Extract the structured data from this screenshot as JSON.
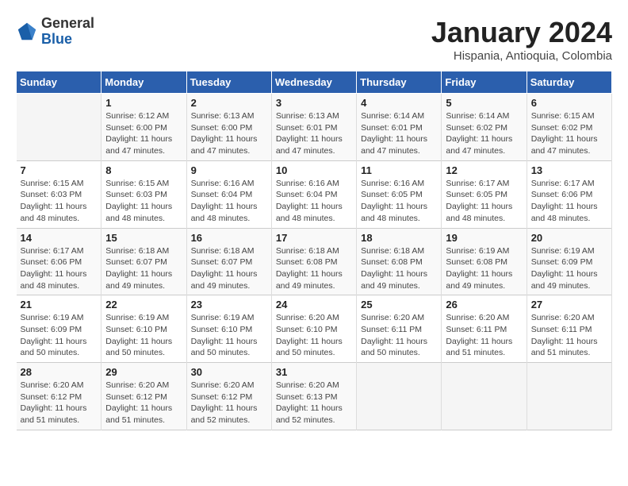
{
  "logo": {
    "general": "General",
    "blue": "Blue"
  },
  "title": "January 2024",
  "subtitle": "Hispania, Antioquia, Colombia",
  "days_of_week": [
    "Sunday",
    "Monday",
    "Tuesday",
    "Wednesday",
    "Thursday",
    "Friday",
    "Saturday"
  ],
  "weeks": [
    [
      {
        "day": "",
        "detail": ""
      },
      {
        "day": "1",
        "detail": "Sunrise: 6:12 AM\nSunset: 6:00 PM\nDaylight: 11 hours\nand 47 minutes."
      },
      {
        "day": "2",
        "detail": "Sunrise: 6:13 AM\nSunset: 6:00 PM\nDaylight: 11 hours\nand 47 minutes."
      },
      {
        "day": "3",
        "detail": "Sunrise: 6:13 AM\nSunset: 6:01 PM\nDaylight: 11 hours\nand 47 minutes."
      },
      {
        "day": "4",
        "detail": "Sunrise: 6:14 AM\nSunset: 6:01 PM\nDaylight: 11 hours\nand 47 minutes."
      },
      {
        "day": "5",
        "detail": "Sunrise: 6:14 AM\nSunset: 6:02 PM\nDaylight: 11 hours\nand 47 minutes."
      },
      {
        "day": "6",
        "detail": "Sunrise: 6:15 AM\nSunset: 6:02 PM\nDaylight: 11 hours\nand 47 minutes."
      }
    ],
    [
      {
        "day": "7",
        "detail": "Sunrise: 6:15 AM\nSunset: 6:03 PM\nDaylight: 11 hours\nand 48 minutes."
      },
      {
        "day": "8",
        "detail": "Sunrise: 6:15 AM\nSunset: 6:03 PM\nDaylight: 11 hours\nand 48 minutes."
      },
      {
        "day": "9",
        "detail": "Sunrise: 6:16 AM\nSunset: 6:04 PM\nDaylight: 11 hours\nand 48 minutes."
      },
      {
        "day": "10",
        "detail": "Sunrise: 6:16 AM\nSunset: 6:04 PM\nDaylight: 11 hours\nand 48 minutes."
      },
      {
        "day": "11",
        "detail": "Sunrise: 6:16 AM\nSunset: 6:05 PM\nDaylight: 11 hours\nand 48 minutes."
      },
      {
        "day": "12",
        "detail": "Sunrise: 6:17 AM\nSunset: 6:05 PM\nDaylight: 11 hours\nand 48 minutes."
      },
      {
        "day": "13",
        "detail": "Sunrise: 6:17 AM\nSunset: 6:06 PM\nDaylight: 11 hours\nand 48 minutes."
      }
    ],
    [
      {
        "day": "14",
        "detail": "Sunrise: 6:17 AM\nSunset: 6:06 PM\nDaylight: 11 hours\nand 48 minutes."
      },
      {
        "day": "15",
        "detail": "Sunrise: 6:18 AM\nSunset: 6:07 PM\nDaylight: 11 hours\nand 49 minutes."
      },
      {
        "day": "16",
        "detail": "Sunrise: 6:18 AM\nSunset: 6:07 PM\nDaylight: 11 hours\nand 49 minutes."
      },
      {
        "day": "17",
        "detail": "Sunrise: 6:18 AM\nSunset: 6:08 PM\nDaylight: 11 hours\nand 49 minutes."
      },
      {
        "day": "18",
        "detail": "Sunrise: 6:18 AM\nSunset: 6:08 PM\nDaylight: 11 hours\nand 49 minutes."
      },
      {
        "day": "19",
        "detail": "Sunrise: 6:19 AM\nSunset: 6:08 PM\nDaylight: 11 hours\nand 49 minutes."
      },
      {
        "day": "20",
        "detail": "Sunrise: 6:19 AM\nSunset: 6:09 PM\nDaylight: 11 hours\nand 49 minutes."
      }
    ],
    [
      {
        "day": "21",
        "detail": "Sunrise: 6:19 AM\nSunset: 6:09 PM\nDaylight: 11 hours\nand 50 minutes."
      },
      {
        "day": "22",
        "detail": "Sunrise: 6:19 AM\nSunset: 6:10 PM\nDaylight: 11 hours\nand 50 minutes."
      },
      {
        "day": "23",
        "detail": "Sunrise: 6:19 AM\nSunset: 6:10 PM\nDaylight: 11 hours\nand 50 minutes."
      },
      {
        "day": "24",
        "detail": "Sunrise: 6:20 AM\nSunset: 6:10 PM\nDaylight: 11 hours\nand 50 minutes."
      },
      {
        "day": "25",
        "detail": "Sunrise: 6:20 AM\nSunset: 6:11 PM\nDaylight: 11 hours\nand 50 minutes."
      },
      {
        "day": "26",
        "detail": "Sunrise: 6:20 AM\nSunset: 6:11 PM\nDaylight: 11 hours\nand 51 minutes."
      },
      {
        "day": "27",
        "detail": "Sunrise: 6:20 AM\nSunset: 6:11 PM\nDaylight: 11 hours\nand 51 minutes."
      }
    ],
    [
      {
        "day": "28",
        "detail": "Sunrise: 6:20 AM\nSunset: 6:12 PM\nDaylight: 11 hours\nand 51 minutes."
      },
      {
        "day": "29",
        "detail": "Sunrise: 6:20 AM\nSunset: 6:12 PM\nDaylight: 11 hours\nand 51 minutes."
      },
      {
        "day": "30",
        "detail": "Sunrise: 6:20 AM\nSunset: 6:12 PM\nDaylight: 11 hours\nand 52 minutes."
      },
      {
        "day": "31",
        "detail": "Sunrise: 6:20 AM\nSunset: 6:13 PM\nDaylight: 11 hours\nand 52 minutes."
      },
      {
        "day": "",
        "detail": ""
      },
      {
        "day": "",
        "detail": ""
      },
      {
        "day": "",
        "detail": ""
      }
    ]
  ]
}
